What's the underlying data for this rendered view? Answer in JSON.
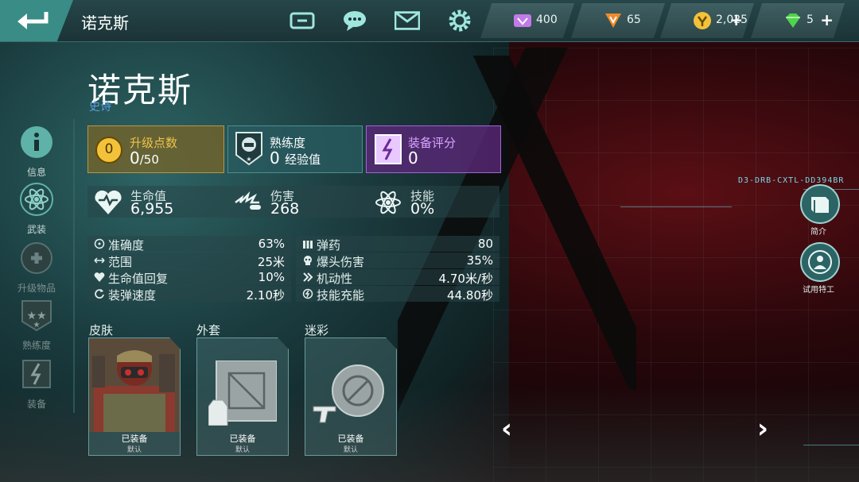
{
  "header": {
    "title": "诺克斯",
    "currencies": [
      {
        "name": "vip-token",
        "value": "400",
        "color": "#c17be8"
      },
      {
        "name": "alliance-token",
        "value": "65",
        "color": "#f08a2a"
      },
      {
        "name": "gold",
        "value": "2,025",
        "color": "#f2c23a",
        "has_plus": true
      },
      {
        "name": "diamond",
        "value": "5",
        "color": "#4fd44b",
        "has_plus": true
      }
    ]
  },
  "sidebar": {
    "items": [
      {
        "label": "信息",
        "icon": "info-icon"
      },
      {
        "label": "武装",
        "icon": "atom-icon"
      },
      {
        "label": "升级物品",
        "icon": "upgrade-items-icon"
      },
      {
        "label": "熟练度",
        "icon": "stars-icon"
      },
      {
        "label": "装备",
        "icon": "equipment-icon"
      }
    ]
  },
  "hero": {
    "name": "诺克斯",
    "rarity": "史诗",
    "upgrade": {
      "title": "升级点数",
      "value": "0",
      "max": "/50",
      "badge": "0"
    },
    "mastery": {
      "title": "熟练度",
      "value": "0",
      "unit": "经验值"
    },
    "gear_score": {
      "title": "装备评分",
      "value": "0"
    }
  },
  "main_stats": [
    {
      "label": "生命值",
      "value": "6,955"
    },
    {
      "label": "伤害",
      "value": "268"
    },
    {
      "label": "技能",
      "value": "0%"
    }
  ],
  "stats": {
    "left": [
      {
        "label": "准确度",
        "value": "63%"
      },
      {
        "label": "范围",
        "value": "25米"
      },
      {
        "label": "生命值回复",
        "value": "10%"
      },
      {
        "label": "装弹速度",
        "value": "2.10秒"
      }
    ],
    "right": [
      {
        "label": "弹药",
        "value": "80"
      },
      {
        "label": "爆头伤害",
        "value": "35%"
      },
      {
        "label": "机动性",
        "value": "4.70米/秒"
      },
      {
        "label": "技能充能",
        "value": "44.80秒"
      }
    ]
  },
  "loadout": [
    {
      "title": "皮肤",
      "status": "已装备",
      "default": "默认"
    },
    {
      "title": "外套",
      "status": "已装备",
      "default": "默认"
    },
    {
      "title": "迷彩",
      "status": "已装备",
      "default": "默认"
    }
  ],
  "right_panel": {
    "intro_label": "简介",
    "trial_label": "试用特工",
    "holo_code": "D3-DRB-CXTL-DD394BR"
  }
}
